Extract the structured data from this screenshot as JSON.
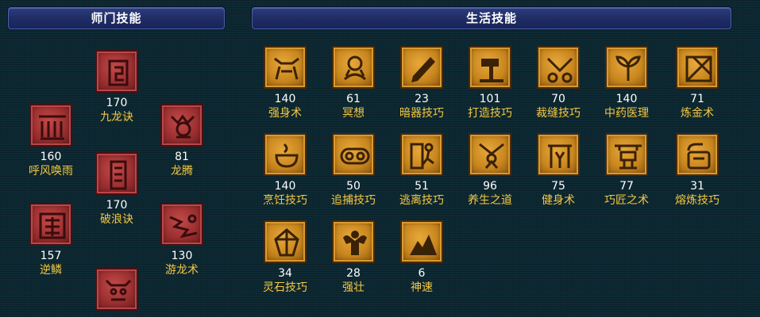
{
  "headers": {
    "school": "师门技能",
    "life": "生活技能"
  },
  "school_skills": [
    {
      "level": "170",
      "name": "九龙诀",
      "icon": "dragon-scroll-icon"
    },
    {
      "level": "160",
      "name": "呼风唤雨",
      "icon": "wind-rain-icon"
    },
    {
      "level": "81",
      "name": "龙腾",
      "icon": "dragon-rise-icon"
    },
    {
      "level": "170",
      "name": "破浪诀",
      "icon": "wave-break-icon"
    },
    {
      "level": "157",
      "name": "逆鳞",
      "icon": "reverse-scale-icon"
    },
    {
      "level": "130",
      "name": "游龙术",
      "icon": "swimming-dragon-icon"
    },
    {
      "level": "",
      "name": "",
      "icon": "dragon-head-icon"
    }
  ],
  "life_skills": [
    {
      "level": "140",
      "name": "强身术",
      "icon": "strong-body-icon"
    },
    {
      "level": "61",
      "name": "冥想",
      "icon": "meditation-icon"
    },
    {
      "level": "23",
      "name": "暗器技巧",
      "icon": "hidden-weapon-icon"
    },
    {
      "level": "101",
      "name": "打造技巧",
      "icon": "forging-hammer-icon"
    },
    {
      "level": "70",
      "name": "裁缝技巧",
      "icon": "tailoring-scissors-icon"
    },
    {
      "level": "140",
      "name": "中药医理",
      "icon": "herbal-medicine-icon"
    },
    {
      "level": "71",
      "name": "炼金术",
      "icon": "alchemy-icon"
    },
    {
      "level": "140",
      "name": "烹饪技巧",
      "icon": "cooking-icon"
    },
    {
      "level": "50",
      "name": "追捕技巧",
      "icon": "pursuit-icon"
    },
    {
      "level": "51",
      "name": "逃离技巧",
      "icon": "escape-icon"
    },
    {
      "level": "96",
      "name": "养生之道",
      "icon": "health-way-icon"
    },
    {
      "level": "75",
      "name": "健身术",
      "icon": "fitness-icon"
    },
    {
      "level": "77",
      "name": "巧匠之术",
      "icon": "craftsman-icon"
    },
    {
      "level": "31",
      "name": "熔炼技巧",
      "icon": "smelting-icon"
    },
    {
      "level": "34",
      "name": "灵石技巧",
      "icon": "spirit-stone-icon"
    },
    {
      "level": "28",
      "name": "强壮",
      "icon": "muscle-icon"
    },
    {
      "level": "6",
      "name": "神速",
      "icon": "godspeed-icon"
    }
  ],
  "colors": {
    "background": "#0e2b35",
    "header_bg": "#1f2c63",
    "level_text": "#ffffff",
    "name_text": "#f5c842",
    "school_icon_bg": "#9b2f30",
    "life_icon_bg": "#c8861e"
  }
}
